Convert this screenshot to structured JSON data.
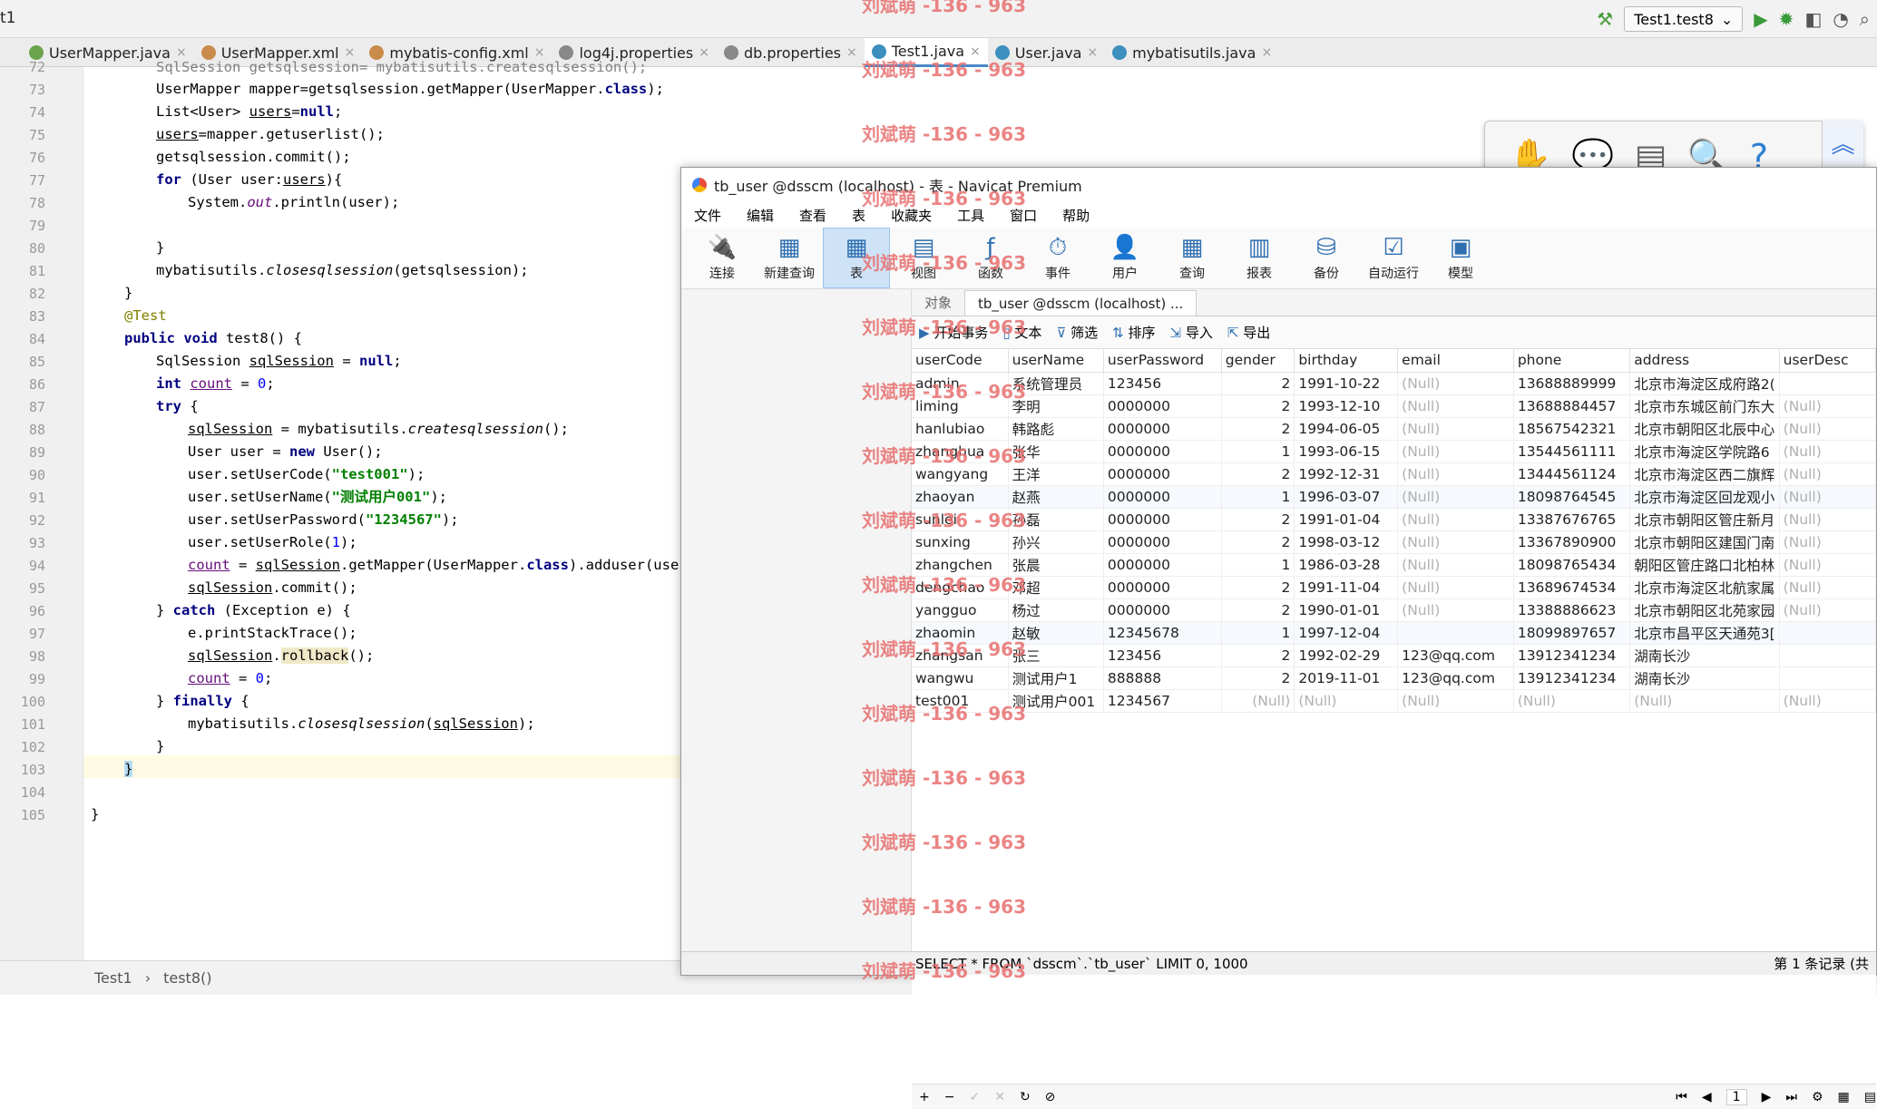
{
  "ide": {
    "project_label": "t1",
    "run_config": "Test1.test8",
    "tabs": [
      {
        "label": "UserMapper.java",
        "icon": "interface-icon",
        "color": "#6ba34f"
      },
      {
        "label": "UserMapper.xml",
        "icon": "xml-icon",
        "color": "#c88b4b"
      },
      {
        "label": "mybatis-config.xml",
        "icon": "xml-icon",
        "color": "#c88b4b"
      },
      {
        "label": "log4j.properties",
        "icon": "properties-icon",
        "color": "#888888"
      },
      {
        "label": "db.properties",
        "icon": "properties-icon",
        "color": "#888888"
      },
      {
        "label": "Test1.java",
        "icon": "class-icon",
        "color": "#3d8fbd"
      },
      {
        "label": "User.java",
        "icon": "class-icon",
        "color": "#3d8fbd"
      },
      {
        "label": "mybatisutils.java",
        "icon": "class-icon",
        "color": "#3d8fbd"
      }
    ],
    "line_numbers": [
      "72",
      "73",
      "74",
      "75",
      "76",
      "77",
      "78",
      "79",
      "80",
      "81",
      "82",
      "83",
      "84",
      "85",
      "86",
      "87",
      "88",
      "89",
      "90",
      "91",
      "92",
      "93",
      "94",
      "95",
      "96",
      "97",
      "98",
      "99",
      "100",
      "101",
      "102",
      "103",
      "104",
      "105"
    ],
    "breadcrumb": [
      "Test1",
      "test8()"
    ]
  },
  "navicat": {
    "title": "tb_user @dsscm (localhost) - 表 - Navicat Premium",
    "menu": [
      "文件",
      "编辑",
      "查看",
      "表",
      "收藏夹",
      "工具",
      "窗口",
      "帮助"
    ],
    "toolbar": [
      {
        "label": "连接",
        "icon": "plug-icon"
      },
      {
        "label": "新建查询",
        "icon": "new-query-icon"
      },
      {
        "label": "表",
        "icon": "table-icon"
      },
      {
        "label": "视图",
        "icon": "view-icon"
      },
      {
        "label": "函数",
        "icon": "function-icon"
      },
      {
        "label": "事件",
        "icon": "clock-icon"
      },
      {
        "label": "用户",
        "icon": "user-icon"
      },
      {
        "label": "查询",
        "icon": "query-icon"
      },
      {
        "label": "报表",
        "icon": "report-icon"
      },
      {
        "label": "备份",
        "icon": "backup-icon"
      },
      {
        "label": "自动运行",
        "icon": "autorun-icon"
      },
      {
        "label": "模型",
        "icon": "model-icon"
      }
    ],
    "obj_tabs": [
      "对象",
      "tb_user @dsscm (localhost) ..."
    ],
    "subtoolbar": [
      "开始事务",
      "文本",
      "筛选",
      "排序",
      "导入",
      "导出"
    ],
    "columns": [
      "userCode",
      "userName",
      "userPassword",
      "gender",
      "birthday",
      "email",
      "phone",
      "address",
      "userDesc"
    ],
    "rows": [
      [
        "admin",
        "系统管理员",
        "123456",
        "2",
        "1991-10-22",
        "(Null)",
        "13688889999",
        "北京市海淀区成府路2(",
        ""
      ],
      [
        "liming",
        "李明",
        "0000000",
        "2",
        "1993-12-10",
        "(Null)",
        "13688884457",
        "北京市东城区前门东大",
        "(Null)"
      ],
      [
        "hanlubiao",
        "韩路彪",
        "0000000",
        "2",
        "1994-06-05",
        "(Null)",
        "18567542321",
        "北京市朝阳区北辰中心",
        "(Null)"
      ],
      [
        "zhanghua",
        "张华",
        "0000000",
        "1",
        "1993-06-15",
        "(Null)",
        "13544561111",
        "北京市海淀区学院路6",
        "(Null)"
      ],
      [
        "wangyang",
        "王洋",
        "0000000",
        "2",
        "1992-12-31",
        "(Null)",
        "13444561124",
        "北京市海淀区西二旗辉",
        "(Null)"
      ],
      [
        "zhaoyan",
        "赵燕",
        "0000000",
        "1",
        "1996-03-07",
        "(Null)",
        "18098764545",
        "北京市海淀区回龙观小",
        "(Null)"
      ],
      [
        "sunlei",
        "孙磊",
        "0000000",
        "2",
        "1991-01-04",
        "(Null)",
        "13387676765",
        "北京市朝阳区管庄新月",
        "(Null)"
      ],
      [
        "sunxing",
        "孙兴",
        "0000000",
        "2",
        "1998-03-12",
        "(Null)",
        "13367890900",
        "北京市朝阳区建国门南",
        "(Null)"
      ],
      [
        "zhangchen",
        "张晨",
        "0000000",
        "1",
        "1986-03-28",
        "(Null)",
        "18098765434",
        "朝阳区管庄路口北柏林",
        "(Null)"
      ],
      [
        "dengchao",
        "邓超",
        "0000000",
        "2",
        "1991-11-04",
        "(Null)",
        "13689674534",
        "北京市海淀区北航家属",
        "(Null)"
      ],
      [
        "yangguo",
        "杨过",
        "0000000",
        "2",
        "1990-01-01",
        "(Null)",
        "13388886623",
        "北京市朝阳区北苑家园",
        "(Null)"
      ],
      [
        "zhaomin",
        "赵敏",
        "12345678",
        "1",
        "1997-12-04",
        "",
        "18099897657",
        "北京市昌平区天通苑3[",
        ""
      ],
      [
        "zhangsan",
        "张三",
        "123456",
        "2",
        "1992-02-29",
        "123@qq.com",
        "13912341234",
        "湖南长沙",
        ""
      ],
      [
        "wangwu",
        "测试用户1",
        "888888",
        "2",
        "2019-11-01",
        "123@qq.com",
        "13912341234",
        "湖南长沙",
        ""
      ],
      [
        "test001",
        "测试用户001",
        "1234567",
        "(Null)",
        "(Null)",
        "(Null)",
        "(Null)",
        "(Null)",
        "(Null)"
      ]
    ],
    "page": "1",
    "sql": "SELECT * FROM `dsscm`.`tb_user` LIMIT 0, 1000",
    "record_status": "第 1 条记录 (共"
  },
  "watermark": "刘斌萌 -136 - 963"
}
